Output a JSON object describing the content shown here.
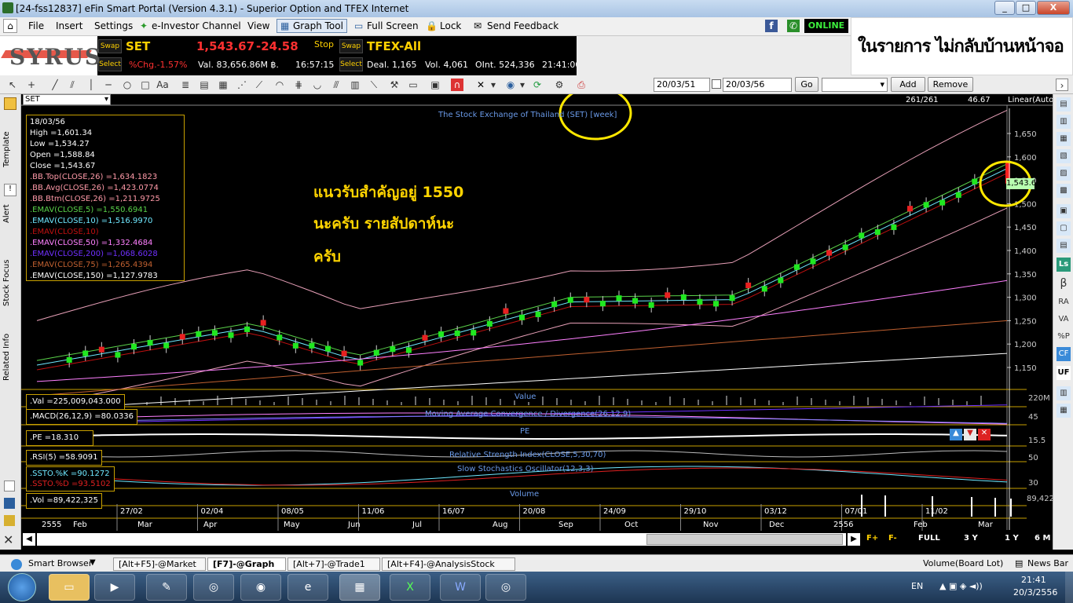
{
  "window": {
    "title": "[24-fss12837] eFin Smart Portal (Version 4.3.1) - Superior Option and TFEX Internet",
    "min": "_",
    "max": "□",
    "close": "X"
  },
  "menu": [
    "File",
    "Insert",
    "Settings",
    "e-Investor Channel",
    "View",
    "Graph Tool",
    "Full Screen",
    "Lock",
    "Send Feedback"
  ],
  "status": "ONLINE",
  "quote": {
    "brand": "SYRUS",
    "swap": "Swap",
    "select": "Select",
    "stop": "Stop",
    "set_symbol": "SET",
    "set_last": "1,543.67",
    "set_change": "-24.58",
    "set_pct": "%Chg.-1.57%",
    "set_val": "Val. 83,656.86M ฿.",
    "set_time": "16:57:15",
    "tfex_symbol": "TFEX-All",
    "tfex_deal": "Deal. 1,165",
    "tfex_vol": "Vol. 4,061",
    "tfex_oi": "OInt. 524,336",
    "tfex_time": "21:41:00"
  },
  "banner": "ในรายการ ไม่กลับบ้านหน้าจอ",
  "toolbar": {
    "from": "20/03/51",
    "to": "20/03/56",
    "go": "Go",
    "add": "Add",
    "remove": "Remove"
  },
  "chart": {
    "symbol": "SET",
    "title": "The Stock Exchange of Thailand (SET) [week]",
    "bars": "261/261",
    "last": "46.67",
    "scale": "Linear(Auto",
    "info_date": "18/03/56",
    "info": [
      {
        "t": "High   =1,601.34",
        "c": "#ffffff"
      },
      {
        "t": "Low    =1,534.27",
        "c": "#ffffff"
      },
      {
        "t": "Open   =1,588.84",
        "c": "#ffffff"
      },
      {
        "t": "Close  =1,543.67",
        "c": "#ffffff"
      },
      {
        "t": ".BB.Top(CLOSE,26)   =1,634.1823",
        "c": "#ff9aa8"
      },
      {
        "t": ".BB.Avg(CLOSE,26)   =1,423.0774",
        "c": "#ff9aa8"
      },
      {
        "t": ".BB.Btm(CLOSE,26)   =1,211.9725",
        "c": "#ff9aa8"
      },
      {
        "t": ".EMAV(CLOSE,5)   =1,550.6941",
        "c": "#5ad24a"
      },
      {
        "t": ".EMAV(CLOSE,10)   =1,516.9970",
        "c": "#6fe8ff"
      },
      {
        "t": ".EMAV(CLOSE,10)",
        "c": "#c01010"
      },
      {
        "t": ".EMAV(CLOSE,50)   =1,332.4684",
        "c": "#ff80ff"
      },
      {
        "t": ".EMAV(CLOSE,200)   =1,068.6028",
        "c": "#7030ff"
      },
      {
        "t": ".EMAV(CLOSE,75)   =1,265.4394",
        "c": "#c06030"
      },
      {
        "t": ".EMAV(CLOSE,150)   =1,127.9783",
        "c": "#ffffff"
      }
    ],
    "note": [
      "แนวรับสำคัญอยู่   1550",
      "นะครับ   รายสัปดาห์นะ",
      "ครับ"
    ],
    "yticks": [
      "1,650",
      "1,600",
      "1,550",
      "1,500",
      "1,450",
      "1,400",
      "1,350",
      "1,300",
      "1,250",
      "1,200",
      "1,150"
    ],
    "ycur": "1,543.67",
    "xdates": [
      "27/02",
      "02/04",
      "08/05",
      "11/06",
      "16/07",
      "20/08",
      "24/09",
      "29/10",
      "03/12",
      "07/01",
      "11/02"
    ],
    "xmonths": [
      "2555",
      "Feb",
      "Mar",
      "Apr",
      "May",
      "Jun",
      "Jul",
      "Aug",
      "Sep",
      "Oct",
      "Nov",
      "Dec",
      "2556",
      "Feb",
      "Mar"
    ],
    "panels": {
      "val_label": ".Val    =225,009,043.000",
      "val_title": "Value",
      "val_scale": "220M",
      "macd_label": ".MACD(26,12,9)    =80.0336",
      "macd_title": "Moving Average Convergence / Divergence(26,12,9)",
      "macd_scale": "45",
      "pe_label": ".PE    =18.310",
      "pe_title": "PE",
      "pe_scale": "15.5",
      "rsi_label": ".RSI(5)    =58.9091",
      "rsi_title": "Relative Strength Index(CLOSE,5,30,70)",
      "rsi_scale": "50",
      "ssto_k": ".SSTO.%K    =90.1272",
      "ssto_d": ".SSTO.%D    =93.5102",
      "ssto_title": "Slow Stochastics Oscillator(12,3,3)",
      "ssto_scale": "30",
      "vol_label": ".Vol    =89,422,325",
      "vol_title": "Volume",
      "vol_scale": "89,422"
    },
    "zoom": [
      "F+",
      "F-",
      "FULL",
      "3 Y",
      "1 Y",
      "6 M"
    ]
  },
  "bottom_tabs": [
    "Smart Browser",
    "[Alt+F5]-@Market",
    "[F7]-@Graph",
    "[Alt+7]-@Trade1",
    "[Alt+F4]-@AnalysisStock"
  ],
  "bottom_right": [
    "Volume(Board Lot)",
    "News Bar"
  ],
  "taskbar": {
    "lang": "EN",
    "time": "21:41",
    "date": "20/3/2556"
  },
  "right_tools": [
    "Ls",
    "β",
    "RA",
    "VA",
    "%P",
    "CF",
    "UF"
  ]
}
